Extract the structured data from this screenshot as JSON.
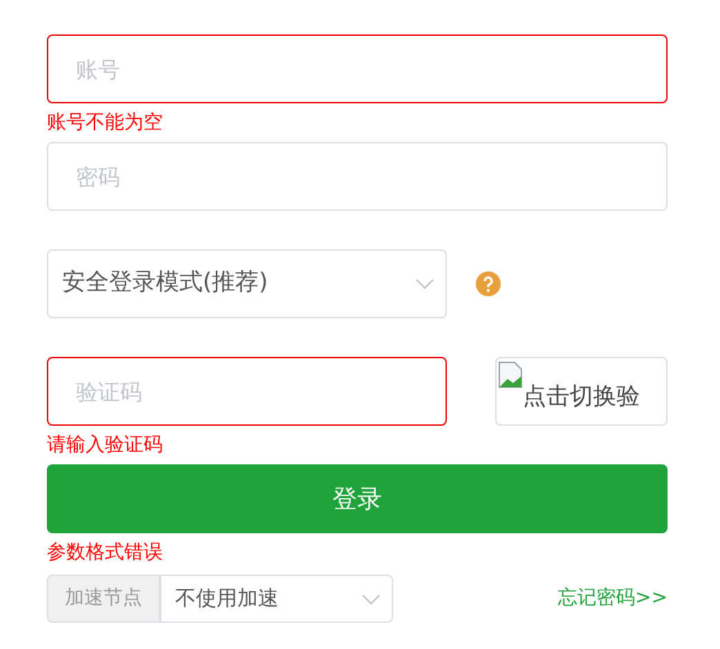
{
  "account": {
    "placeholder": "账号",
    "error": true,
    "error_text": "账号不能为空"
  },
  "password": {
    "placeholder": "密码",
    "error": false
  },
  "mode_select": {
    "value": "安全登录模式(推荐)"
  },
  "captcha": {
    "placeholder": "验证码",
    "error": true,
    "error_text": "请输入验证码",
    "image_alt": "点击切换验"
  },
  "login_button": {
    "label": "登录",
    "error_text": "参数格式错误"
  },
  "accel": {
    "label": "加速节点",
    "value": "不使用加速"
  },
  "forgot_link": {
    "label": "忘记密码",
    "arrows": ">>"
  }
}
